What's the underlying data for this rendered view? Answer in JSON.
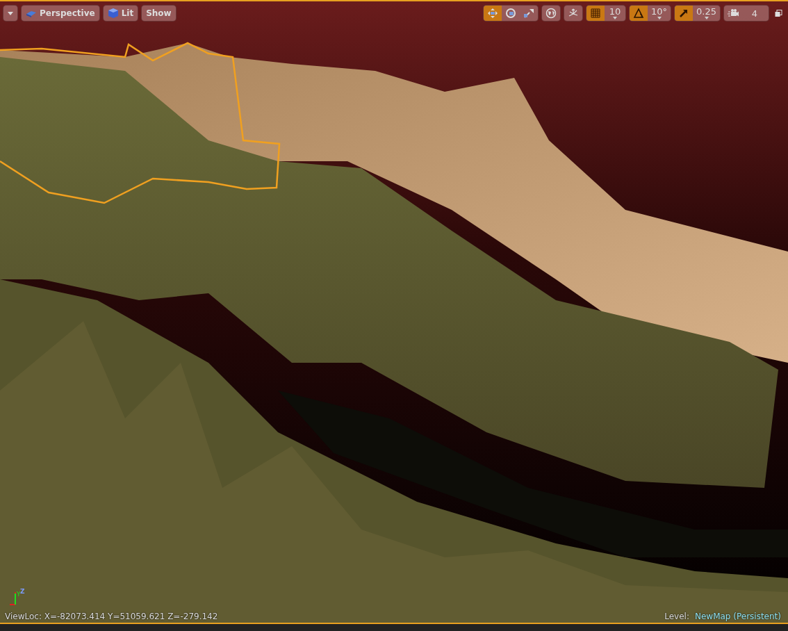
{
  "toolbar_left": [
    {
      "kind": "menu"
    },
    {
      "kind": "perspective",
      "label": "Perspective"
    },
    {
      "kind": "lit",
      "label": "Lit"
    },
    {
      "kind": "show",
      "label": "Show"
    }
  ],
  "transform_tools": [
    {
      "kind": "translate",
      "selected": true
    },
    {
      "kind": "rotate",
      "selected": false
    },
    {
      "kind": "scale",
      "selected": false
    }
  ],
  "snap_groups": [
    {
      "kind": "world"
    },
    {
      "kind": "surface",
      "on": false
    },
    {
      "kind": "grid",
      "on": true,
      "value": "10"
    },
    {
      "kind": "rotation",
      "on": true,
      "value": "10°"
    },
    {
      "kind": "scale",
      "on": true,
      "value": "0.25"
    },
    {
      "kind": "camera",
      "value": "4"
    }
  ],
  "axis_gizmo": {
    "labels": [
      "Y",
      "Z"
    ]
  },
  "view_location": "ViewLoc: X=-82073.414 Y=51059.621 Z=-279.142",
  "level": {
    "label": "Level:",
    "name": "NewMap (Persistent)"
  }
}
